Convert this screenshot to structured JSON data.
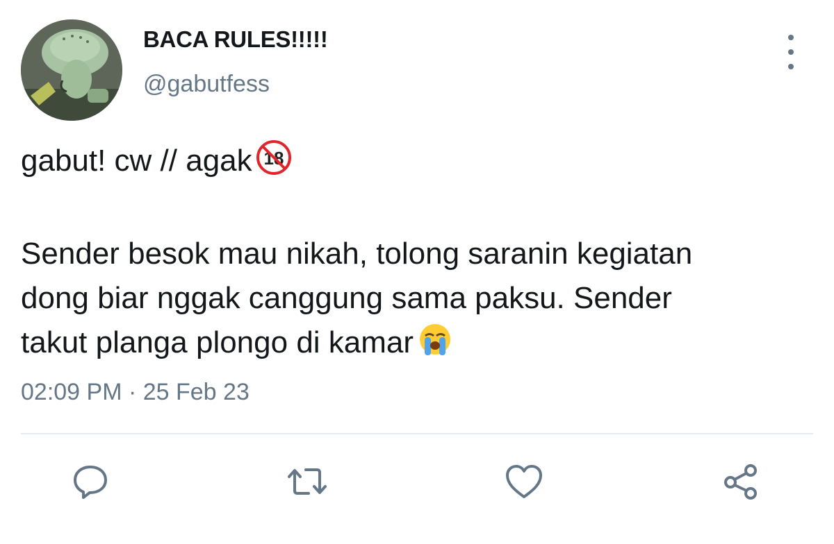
{
  "header": {
    "display_name": "BACA RULES!!!!!",
    "handle": "@gabutfess"
  },
  "tweet": {
    "line1": "gabut! cw // agak",
    "line1_emoji": "no-one-under-eighteen-emoji",
    "body_lines": [
      "Sender besok mau nikah, tolong saranin kegiatan",
      "dong biar nggak canggung sama paksu. Sender",
      "takut planga plongo di kamar"
    ],
    "body_emoji": "loudly-crying-face-emoji",
    "timestamp": "02:09 PM · 25 Feb 23"
  },
  "actions": [
    "reply-icon",
    "retweet-icon",
    "like-icon",
    "share-icon"
  ],
  "colors": {
    "text": "#14171a",
    "secondary": "#657786",
    "divider": "#e6ecf0",
    "no_entry_red": "#e0262b"
  }
}
